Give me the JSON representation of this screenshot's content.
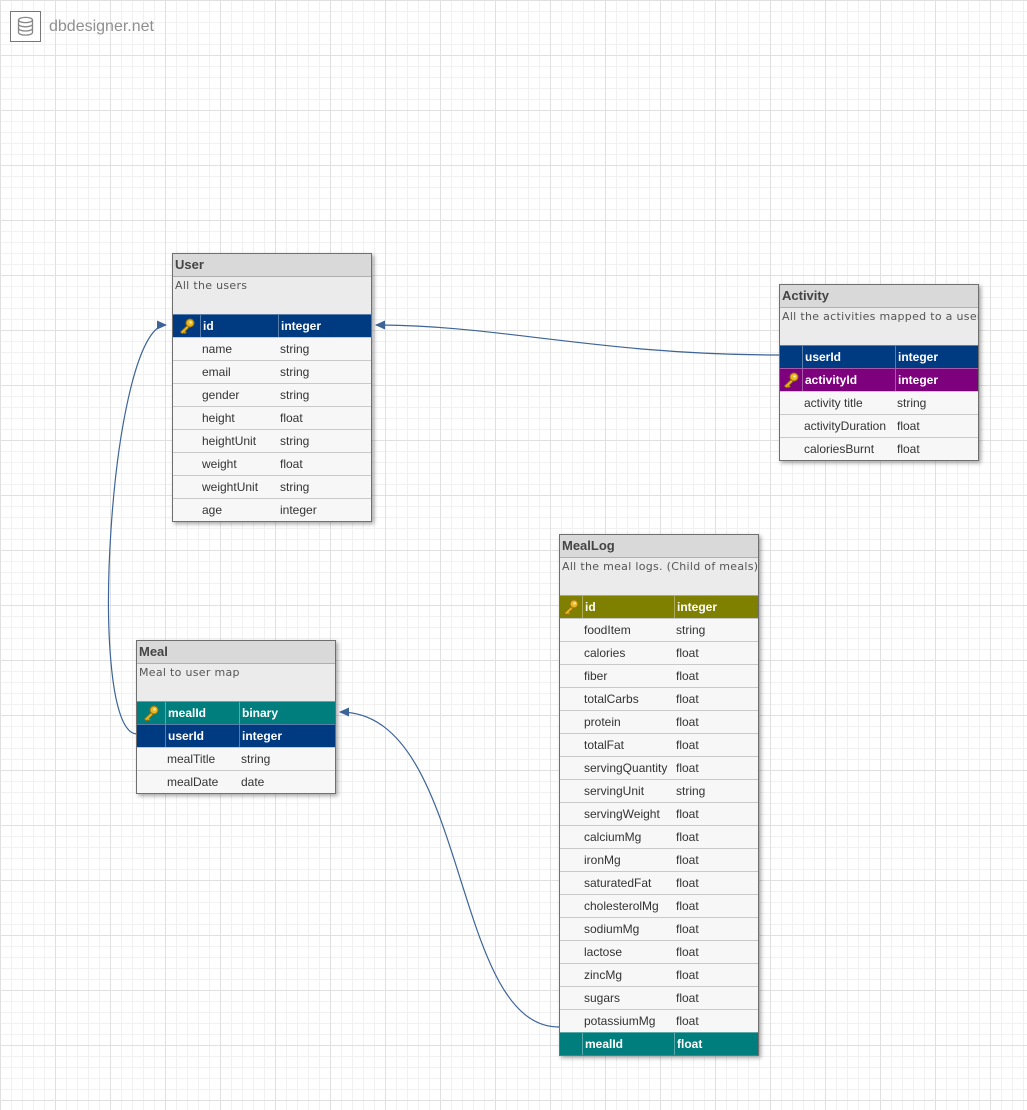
{
  "brand": {
    "icon": "database-icon",
    "text": "dbdesigner.net"
  },
  "colors": {
    "link": "#3c6497"
  },
  "tables": [
    {
      "id": "user",
      "name": "User",
      "description": "All the users",
      "fields": [
        {
          "name": "id",
          "type": "integer",
          "key": true,
          "highlight": "#003a80"
        },
        {
          "name": "name",
          "type": "string"
        },
        {
          "name": "email",
          "type": "string"
        },
        {
          "name": "gender",
          "type": "string"
        },
        {
          "name": "height",
          "type": "float"
        },
        {
          "name": "heightUnit",
          "type": "string"
        },
        {
          "name": "weight",
          "type": "float"
        },
        {
          "name": "weightUnit",
          "type": "string"
        },
        {
          "name": "age",
          "type": "integer"
        }
      ]
    },
    {
      "id": "activity",
      "name": "Activity",
      "description": "All the activities mapped to a userId",
      "fields": [
        {
          "name": "userId",
          "type": "integer",
          "highlight": "#003a80"
        },
        {
          "name": "activityId",
          "type": "integer",
          "key": true,
          "highlight": "#7d007d"
        },
        {
          "name": "activity title",
          "type": "string"
        },
        {
          "name": "activityDuration",
          "type": "float"
        },
        {
          "name": "caloriesBurnt",
          "type": "float"
        }
      ]
    },
    {
      "id": "meal",
      "name": "Meal",
      "description": "Meal to user map",
      "fields": [
        {
          "name": "mealId",
          "type": "binary",
          "key": true,
          "highlight": "#007d7d"
        },
        {
          "name": "userId",
          "type": "integer",
          "highlight": "#003a80"
        },
        {
          "name": "mealTitle",
          "type": "string"
        },
        {
          "name": "mealDate",
          "type": "date"
        }
      ]
    },
    {
      "id": "meallog",
      "name": "MealLog",
      "description": "All the meal logs. (Child of meals)",
      "fields": [
        {
          "name": "id",
          "type": "integer",
          "key": true,
          "highlight": "#808000"
        },
        {
          "name": "foodItem",
          "type": "string"
        },
        {
          "name": "calories",
          "type": "float"
        },
        {
          "name": "fiber",
          "type": "float"
        },
        {
          "name": "totalCarbs",
          "type": "float"
        },
        {
          "name": "protein",
          "type": "float"
        },
        {
          "name": "totalFat",
          "type": "float"
        },
        {
          "name": "servingQuantity",
          "type": "float"
        },
        {
          "name": "servingUnit",
          "type": "string"
        },
        {
          "name": "servingWeight",
          "type": "float"
        },
        {
          "name": "calciumMg",
          "type": "float"
        },
        {
          "name": "ironMg",
          "type": "float"
        },
        {
          "name": "saturatedFat",
          "type": "float"
        },
        {
          "name": "cholesterolMg",
          "type": "float"
        },
        {
          "name": "sodiumMg",
          "type": "float"
        },
        {
          "name": "lactose",
          "type": "float"
        },
        {
          "name": "zincMg",
          "type": "float"
        },
        {
          "name": "sugars",
          "type": "float"
        },
        {
          "name": "potassiumMg",
          "type": "float"
        },
        {
          "name": "mealId",
          "type": "float",
          "highlight": "#007d7d"
        }
      ]
    }
  ],
  "relations": [
    {
      "from": "activity.userId",
      "to": "user.id"
    },
    {
      "from": "meal.userId",
      "to": "user.id"
    },
    {
      "from": "meallog.mealId",
      "to": "meal.mealId"
    }
  ]
}
